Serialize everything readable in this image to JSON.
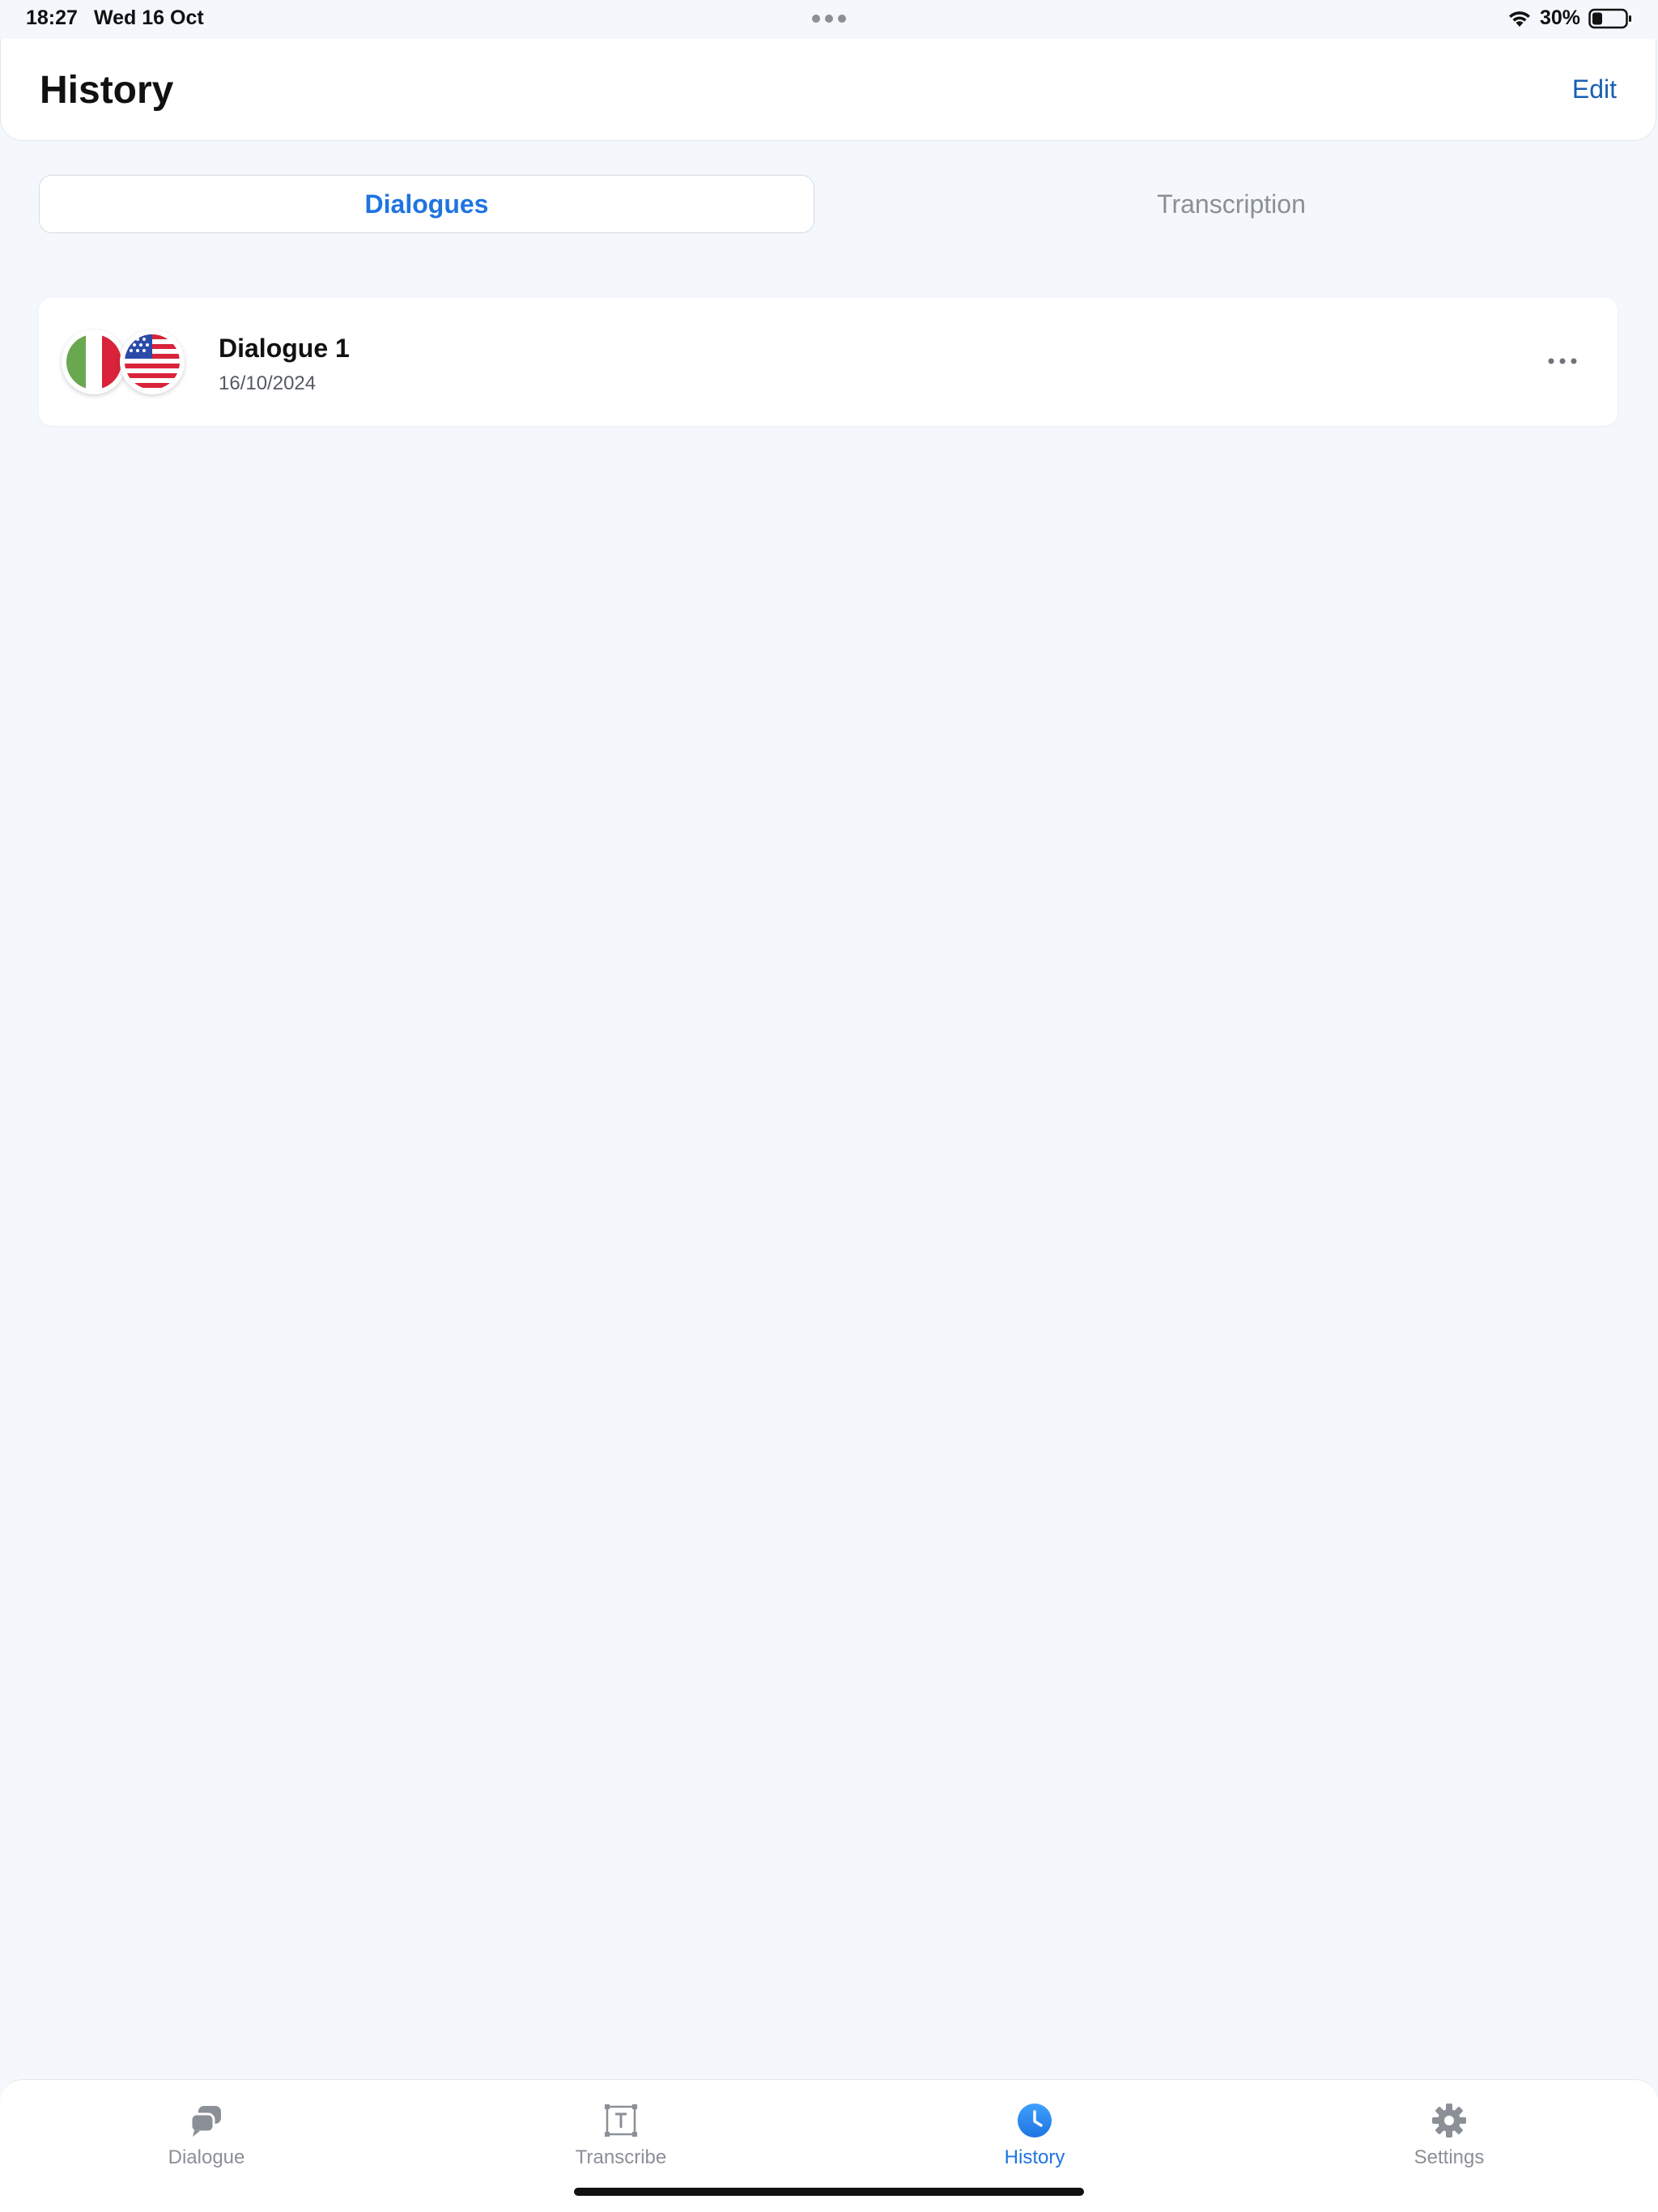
{
  "status_bar": {
    "time": "18:27",
    "date": "Wed 16 Oct",
    "battery": "30%"
  },
  "header": {
    "title": "History",
    "edit_label": "Edit"
  },
  "segments": [
    {
      "label": "Dialogues",
      "active": true
    },
    {
      "label": "Transcription",
      "active": false
    }
  ],
  "dialogues": [
    {
      "title": "Dialogue 1",
      "date": "16/10/2024",
      "flags": [
        "italy-flag-icon",
        "usa-flag-icon"
      ]
    }
  ],
  "tab_bar": {
    "items": [
      {
        "label": "Dialogue",
        "icon": "chat-bubbles-icon",
        "active": false
      },
      {
        "label": "Transcribe",
        "icon": "text-box-icon",
        "active": false
      },
      {
        "label": "History",
        "icon": "clock-icon",
        "active": true
      },
      {
        "label": "Settings",
        "icon": "gear-icon",
        "active": false
      }
    ]
  },
  "colors": {
    "accent": "#1f74e0",
    "edit_link": "#1a5fb4",
    "background": "#f4f7fc",
    "inactive": "#8b8f96"
  }
}
